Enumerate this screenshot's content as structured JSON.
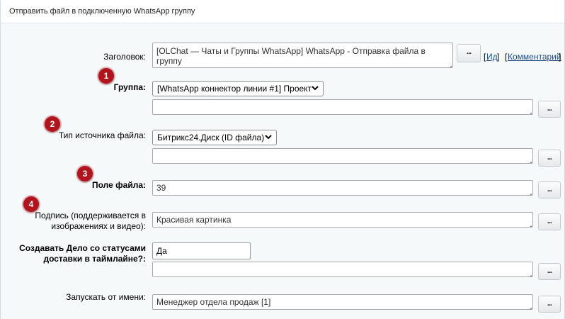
{
  "window": {
    "title": "Отправить файл в подключенную WhatsApp группу"
  },
  "fields": {
    "title": {
      "label": "Заголовок:",
      "value": "[OLChat — Чаты и Группы WhatsApp] WhatsApp - Отправка файла в группу",
      "id_link": "Ид",
      "comment_link": "Комментарий"
    },
    "group": {
      "label": "Группа:",
      "selected": "[WhatsApp коннектор линии #1] Проект",
      "textarea": ""
    },
    "source_type": {
      "label": "Тип источника файла:",
      "selected": "Битрикс24.Диск (ID файла)",
      "textarea": ""
    },
    "file_field": {
      "label": "Поле файла:",
      "value": "39"
    },
    "caption": {
      "label_line1": "Подпись (поддерживается в",
      "label_line2": "изображениях и видео):",
      "value": "Красивая картинка"
    },
    "create_task": {
      "label_line1": "Создавать Дело со статусами",
      "label_line2": "доставки в таймлайне?:",
      "value": "Да",
      "textarea": ""
    },
    "run_as": {
      "label": "Запускать от имени:",
      "value": "Менеджер отдела продаж [1]"
    }
  },
  "buttons": {
    "ellipsis": "..."
  },
  "badges": [
    "1",
    "2",
    "3",
    "4"
  ],
  "colors": {
    "badge": "#b1141d",
    "link": "#1c4e8e",
    "background": "#f5f9f9"
  }
}
